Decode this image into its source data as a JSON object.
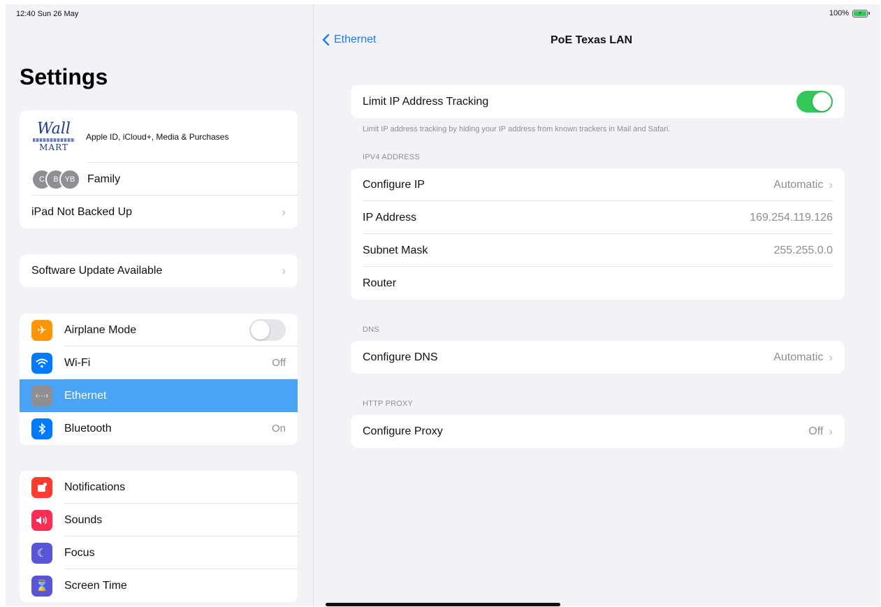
{
  "status_bar": {
    "time": "12:40  Sun 26 May",
    "battery_percent": "100%",
    "battery_level": 1.0
  },
  "sidebar": {
    "title": "Settings",
    "account": {
      "logo_text_top": "Wall",
      "logo_text_bottom": "MART",
      "subtitle": "Apple ID, iCloud+, Media & Purchases",
      "family_label": "Family",
      "family_avatars": [
        "C",
        "B",
        "YB"
      ],
      "backup_label": "iPad Not Backed Up"
    },
    "software_update": "Software Update Available",
    "network": [
      {
        "label": "Airplane Mode",
        "icon": "airplane-icon",
        "color": "#ff9500",
        "toggle": "off"
      },
      {
        "label": "Wi-Fi",
        "icon": "wifi-icon",
        "color": "#007aff",
        "value": "Off"
      },
      {
        "label": "Ethernet",
        "icon": "ethernet-icon",
        "color": "#8e8e93",
        "selected": true
      },
      {
        "label": "Bluetooth",
        "icon": "bluetooth-icon",
        "color": "#007aff",
        "value": "On"
      }
    ],
    "general": [
      {
        "label": "Notifications",
        "icon": "notifications-icon",
        "color": "#ff3b30"
      },
      {
        "label": "Sounds",
        "icon": "sounds-icon",
        "color": "#ff2d55"
      },
      {
        "label": "Focus",
        "icon": "focus-icon",
        "color": "#5856d6"
      },
      {
        "label": "Screen Time",
        "icon": "screen-time-icon",
        "color": "#5856d6"
      }
    ]
  },
  "detail": {
    "back_label": "Ethernet",
    "title": "PoE Texas  LAN",
    "limit_tracking": {
      "label": "Limit IP Address Tracking",
      "state": "on",
      "footnote": "Limit IP address tracking by hiding your IP address from known trackers in Mail and Safari."
    },
    "ipv4": {
      "header": "IPV4 ADDRESS",
      "configure_ip": {
        "label": "Configure IP",
        "value": "Automatic"
      },
      "ip_address": {
        "label": "IP Address",
        "value": "169.254.119.126"
      },
      "subnet_mask": {
        "label": "Subnet Mask",
        "value": "255.255.0.0"
      },
      "router": {
        "label": "Router",
        "value": ""
      }
    },
    "dns": {
      "header": "DNS",
      "configure_dns": {
        "label": "Configure DNS",
        "value": "Automatic"
      }
    },
    "proxy": {
      "header": "HTTP PROXY",
      "configure_proxy": {
        "label": "Configure Proxy",
        "value": "Off"
      }
    }
  },
  "colors": {
    "accent": "#1e7cf2",
    "selected_row": "#4aa3f5",
    "toggle_on": "#34c759"
  }
}
